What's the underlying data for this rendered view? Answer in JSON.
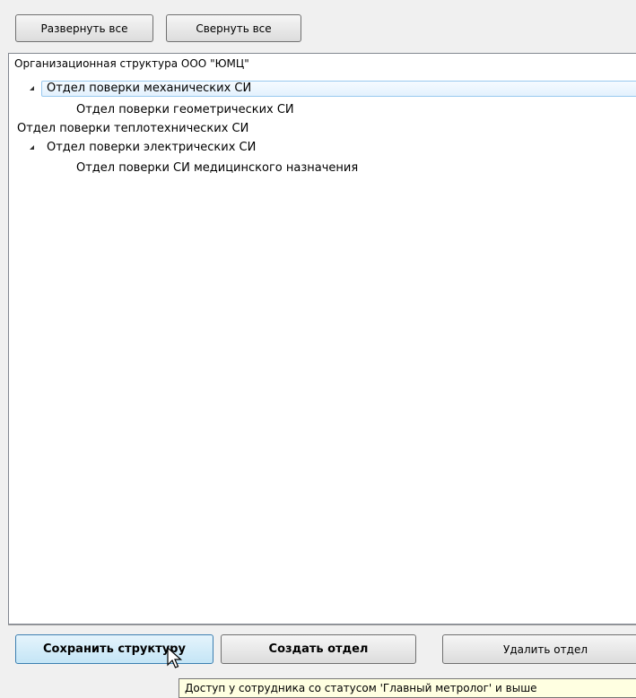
{
  "toolbar": {
    "expand_all_label": "Развернуть все",
    "collapse_all_label": "Свернуть все"
  },
  "tree": {
    "title": "Организационная структура ООО \"ЮМЦ\"",
    "nodes": [
      {
        "label": "Отдел поверки механических СИ",
        "level": 0,
        "expanded": true,
        "selected": true
      },
      {
        "label": "Отдел поверки геометрических СИ",
        "level": 1
      },
      {
        "label": "Отдел поверки теплотехнических СИ",
        "level": 0
      },
      {
        "label": "Отдел поверки электрических СИ",
        "level": 0,
        "expanded": true
      },
      {
        "label": "Отдел поверки СИ медицинского назначения",
        "level": 1
      }
    ]
  },
  "actions": {
    "save_label": "Сохранить структуру",
    "create_label": "Создать отдел",
    "delete_label": "Удалить отдел"
  },
  "tooltip": {
    "text": "Доступ у сотрудника со статусом 'Главный метролог' и выше"
  },
  "icons": {
    "expander": "expanded-triangle-icon",
    "cursor": "mouse-pointer-icon"
  }
}
